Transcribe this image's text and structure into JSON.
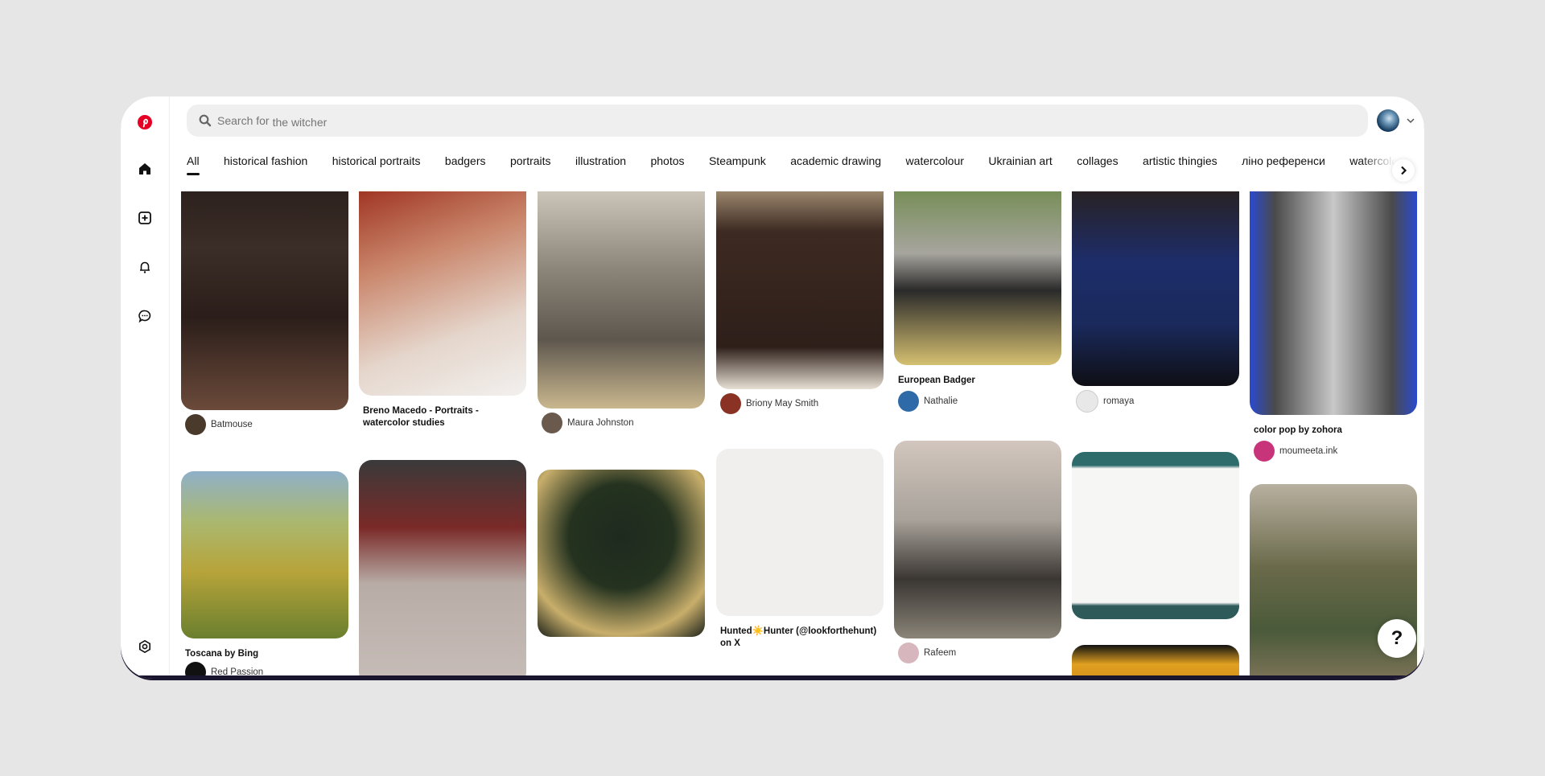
{
  "app": {
    "name": "Pinterest",
    "brand_color": "#e60023"
  },
  "sidebar": {
    "items": [
      {
        "name": "home",
        "icon": "home-icon"
      },
      {
        "name": "create",
        "icon": "plus-square-icon"
      },
      {
        "name": "notifications",
        "icon": "bell-icon"
      },
      {
        "name": "messages",
        "icon": "chat-icon"
      },
      {
        "name": "settings",
        "icon": "gear-icon"
      }
    ]
  },
  "search": {
    "placeholder": "Search for",
    "suggestion": "the witcher"
  },
  "tabs": [
    {
      "label": "All",
      "active": true
    },
    {
      "label": "historical fashion"
    },
    {
      "label": "historical portraits"
    },
    {
      "label": "badgers"
    },
    {
      "label": "portraits"
    },
    {
      "label": "illustration"
    },
    {
      "label": "photos"
    },
    {
      "label": "Steampunk"
    },
    {
      "label": "academic drawing"
    },
    {
      "label": "watercolour"
    },
    {
      "label": "Ukrainian art"
    },
    {
      "label": "collages"
    },
    {
      "label": "artistic thingies"
    },
    {
      "label": "ліно референси"
    },
    {
      "label": "watercolor"
    }
  ],
  "pins": [
    {
      "title": "",
      "user": "Batmouse"
    },
    {
      "title": "Breno Macedo - Portraits - watercolor studies",
      "user": ""
    },
    {
      "title": "",
      "user": "Maura Johnston"
    },
    {
      "title": "",
      "user": "Briony May Smith"
    },
    {
      "title": "European Badger",
      "user": "Nathalie"
    },
    {
      "title": "",
      "user": "romaya"
    },
    {
      "title": "color pop by zohora",
      "user": "moumeeta.ink"
    },
    {
      "title": "Toscana by Bing",
      "user": "Red Passion"
    },
    {
      "title": "",
      "user": ""
    },
    {
      "title": "",
      "user": ""
    },
    {
      "title": "Hunted☀️Hunter (@lookforthehunt) on X",
      "user": ""
    },
    {
      "title": "",
      "user": "Rafeem"
    },
    {
      "title": "",
      "user": ""
    },
    {
      "title": "",
      "user": ""
    },
    {
      "title": "",
      "user": ""
    }
  ],
  "help": {
    "label": "?"
  }
}
